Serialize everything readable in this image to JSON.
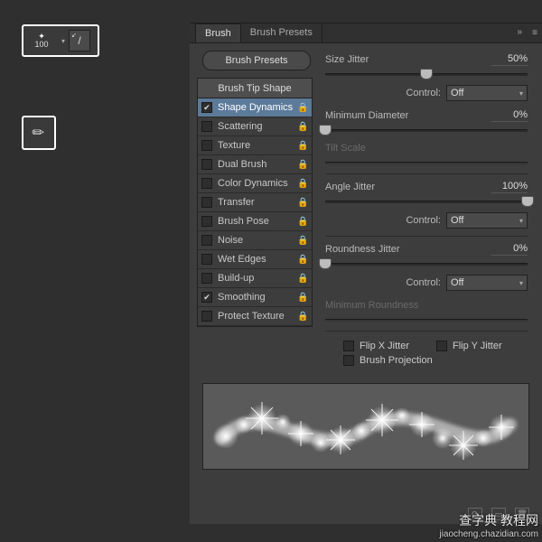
{
  "toolbar": {
    "brush_size": "100"
  },
  "panel": {
    "tabs": {
      "brush": "Brush",
      "presets": "Brush Presets"
    },
    "brush_presets_btn": "Brush Presets",
    "list_header": "Brush Tip Shape",
    "items": [
      {
        "label": "Shape Dynamics",
        "checked": true,
        "active": true
      },
      {
        "label": "Scattering",
        "checked": false,
        "active": false
      },
      {
        "label": "Texture",
        "checked": false,
        "active": false
      },
      {
        "label": "Dual Brush",
        "checked": false,
        "active": false
      },
      {
        "label": "Color Dynamics",
        "checked": false,
        "active": false
      },
      {
        "label": "Transfer",
        "checked": false,
        "active": false
      },
      {
        "label": "Brush Pose",
        "checked": false,
        "active": false
      },
      {
        "label": "Noise",
        "checked": false,
        "active": false
      },
      {
        "label": "Wet Edges",
        "checked": false,
        "active": false
      },
      {
        "label": "Build-up",
        "checked": false,
        "active": false
      },
      {
        "label": "Smoothing",
        "checked": true,
        "active": false
      },
      {
        "label": "Protect Texture",
        "checked": false,
        "active": false
      }
    ]
  },
  "settings": {
    "size_jitter": {
      "label": "Size Jitter",
      "value": "50%",
      "thumb": 50
    },
    "control1": {
      "label": "Control:",
      "value": "Off"
    },
    "min_diameter": {
      "label": "Minimum Diameter",
      "value": "0%",
      "thumb": 0
    },
    "tilt_scale": {
      "label": "Tilt Scale"
    },
    "angle_jitter": {
      "label": "Angle Jitter",
      "value": "100%",
      "thumb": 100
    },
    "control2": {
      "label": "Control:",
      "value": "Off"
    },
    "roundness_jitter": {
      "label": "Roundness Jitter",
      "value": "0%",
      "thumb": 0
    },
    "control3": {
      "label": "Control:",
      "value": "Off"
    },
    "min_roundness": {
      "label": "Minimum Roundness"
    },
    "flip_x": "Flip X Jitter",
    "flip_y": "Flip Y Jitter",
    "brush_projection": "Brush Projection"
  },
  "watermark": {
    "line1": "查字典 教程网",
    "line2": "jiaocheng.chazidian.com"
  }
}
